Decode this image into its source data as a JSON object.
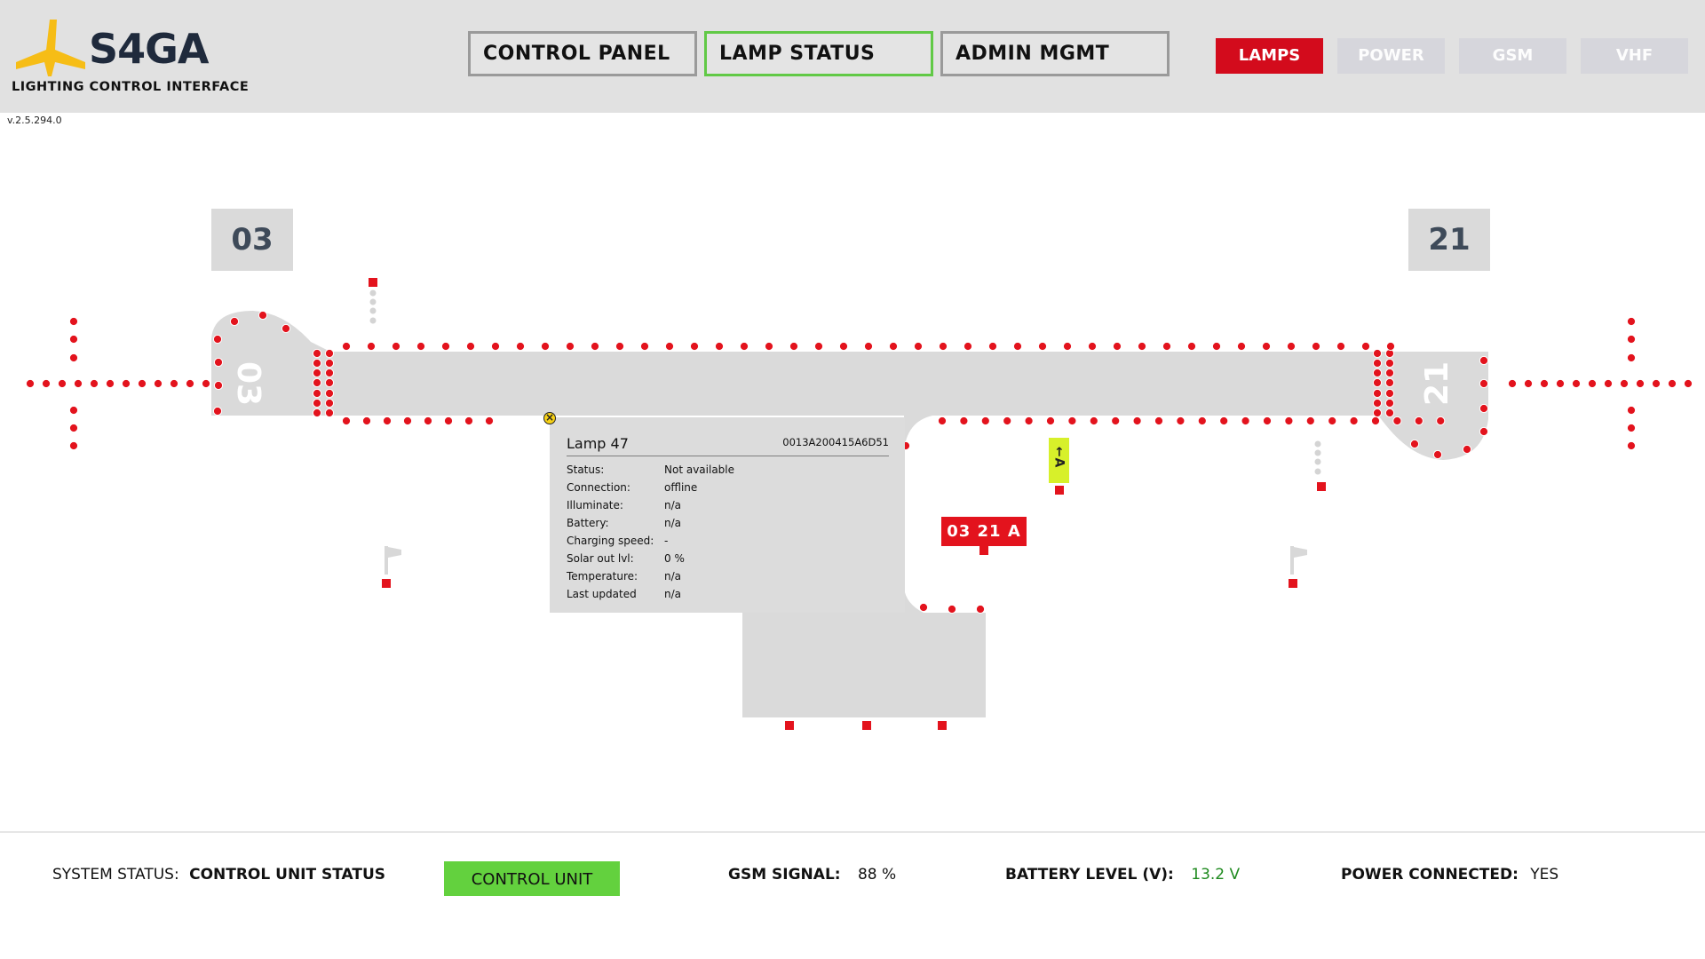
{
  "app": {
    "logo_text": "S4GA",
    "subtitle": "LIGHTING CONTROL INTERFACE",
    "version": "v.2.5.294.0",
    "accent_color": "#d30b1c",
    "logo_color": "#f6bd16"
  },
  "nav": {
    "tabs": [
      {
        "label": "CONTROL PANEL",
        "active": false
      },
      {
        "label": "LAMP STATUS",
        "active": true
      },
      {
        "label": "ADMIN MGMT",
        "active": false
      }
    ],
    "modes": [
      {
        "label": "LAMPS",
        "active": true
      },
      {
        "label": "POWER",
        "active": false
      },
      {
        "label": "GSM",
        "active": false
      },
      {
        "label": "VHF",
        "active": false
      }
    ]
  },
  "map": {
    "runway_badges": [
      "03",
      "21"
    ],
    "runway_marking_left": "03",
    "runway_marking_right": "21",
    "red_sign": "03 21 A",
    "yellow_sign": "A",
    "lamp_color": "#e3131d",
    "surface_color": "#dadada"
  },
  "lamp_popup": {
    "title": "Lamp 47",
    "device_id": "0013A200415A6D51",
    "close_icon": "close-circle-icon",
    "rows": [
      {
        "label": "Status:",
        "value": "Not available"
      },
      {
        "label": "Connection:",
        "value": "offline"
      },
      {
        "label": "Illuminate:",
        "value": "n/a"
      },
      {
        "label": "Battery:",
        "value": "n/a"
      },
      {
        "label": "Charging speed:",
        "value": "-"
      },
      {
        "label": "Solar out lvl:",
        "value": "0 %"
      },
      {
        "label": "Temperature:",
        "value": "n/a"
      },
      {
        "label": "Last updated",
        "value": "n/a"
      }
    ]
  },
  "footer": {
    "system_status_label": "SYSTEM STATUS:",
    "system_status_value": "CONTROL UNIT STATUS",
    "control_unit_badge": "CONTROL UNIT",
    "gsm_label": "GSM SIGNAL:",
    "gsm_value": "88 %",
    "battery_label": "BATTERY LEVEL (V):",
    "battery_value": "13.2 V",
    "battery_color": "#1f8a1f",
    "power_label": "POWER CONNECTED:",
    "power_value": "YES"
  }
}
